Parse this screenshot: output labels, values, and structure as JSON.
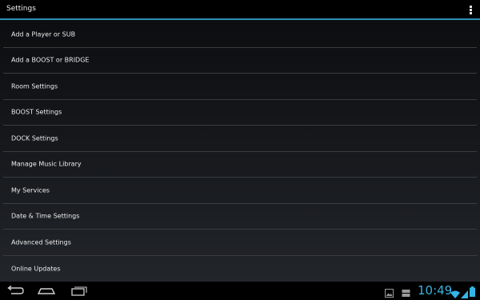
{
  "action_bar": {
    "title": "Settings",
    "overflow_icon": "overflow-menu-icon"
  },
  "settings_items": [
    {
      "label": "Add a Player or SUB"
    },
    {
      "label": "Add a BOOST or BRIDGE"
    },
    {
      "label": "Room Settings"
    },
    {
      "label": "BOOST Settings"
    },
    {
      "label": "DOCK Settings"
    },
    {
      "label": "Manage Music Library"
    },
    {
      "label": "My Services"
    },
    {
      "label": "Date & Time Settings"
    },
    {
      "label": "Advanced Settings"
    },
    {
      "label": "Online Updates"
    }
  ],
  "system_bar": {
    "time": "10:49",
    "icons": [
      "back-icon",
      "home-icon",
      "recent-apps-icon",
      "gallery-notification-icon",
      "storage-notification-icon",
      "wifi-icon",
      "signal-icon",
      "battery-icon"
    ]
  },
  "colors": {
    "accent": "#33b5e5",
    "divider": "#3a3c40",
    "action_bar_underline": "#2f8fb6"
  }
}
